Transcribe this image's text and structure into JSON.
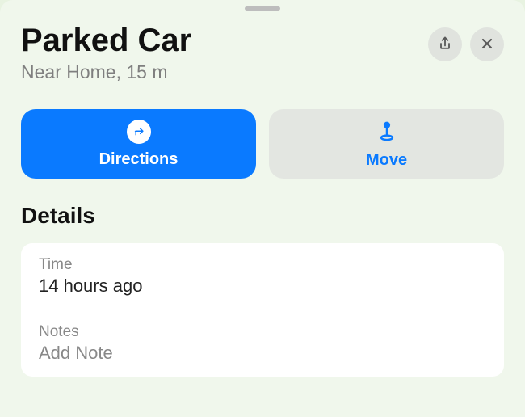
{
  "header": {
    "title": "Parked Car",
    "subtitle": "Near Home, 15 m"
  },
  "actions": {
    "directions_label": "Directions",
    "move_label": "Move"
  },
  "sections": {
    "details_heading": "Details"
  },
  "details": {
    "time_label": "Time",
    "time_value": "14 hours ago",
    "notes_label": "Notes",
    "notes_placeholder": "Add Note"
  }
}
